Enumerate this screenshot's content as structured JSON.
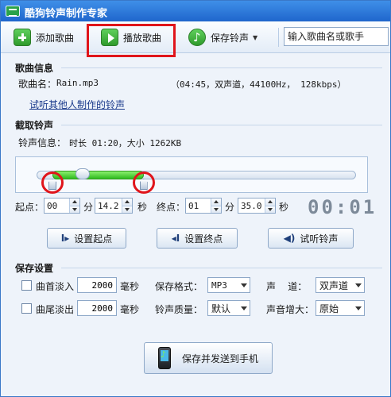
{
  "window": {
    "title": "酷狗铃声制作专家"
  },
  "toolbar": {
    "add_song": "添加歌曲",
    "play_song": "播放歌曲",
    "save_ringtone": "保存铃声",
    "search_value": "输入歌曲名或歌手"
  },
  "song_info": {
    "title": "歌曲信息",
    "name_label": "歌曲名：",
    "name_value": "Rain.mp3",
    "details": "（04:45，双声道，44100Hz，  128kbps）",
    "link": "试听其他人制作的铃声"
  },
  "clip": {
    "title": "截取铃声",
    "info_label": "铃声信息：",
    "info_value": "时长 01:20，大小 1262KB",
    "slider": {
      "start_fraction": 0.05,
      "end_fraction": 0.335,
      "position_fraction": 0.145
    },
    "start_label": "起点：",
    "start_min": "00",
    "min_unit_1": "分",
    "start_sec": "14.2",
    "sec_unit_1": "秒",
    "end_label": "终点：",
    "end_min": "01",
    "min_unit_2": "分",
    "end_sec": "35.0",
    "sec_unit_2": "秒",
    "timer": "00:01",
    "set_start": "设置起点",
    "set_end": "设置终点",
    "preview": "试听铃声"
  },
  "save_settings": {
    "title": "保存设置",
    "fade_in": "曲首淡入",
    "fade_in_value": "2000",
    "ms_unit_1": "毫秒",
    "fade_out": "曲尾淡出",
    "fade_out_value": "2000",
    "ms_unit_2": "毫秒",
    "format_label": "保存格式：",
    "format_value": "MP3",
    "channel_label": "声    道：",
    "channel_value": "双声道",
    "quality_label": "铃声质量：",
    "quality_value": "默认",
    "volume_label": "声音增大：",
    "volume_value": "原始",
    "save_send": "保存并发送到手机"
  },
  "colors": {
    "title_bar": "#2a78dc",
    "accent_green": "#2fba1e",
    "highlight_red": "#e0151b"
  }
}
